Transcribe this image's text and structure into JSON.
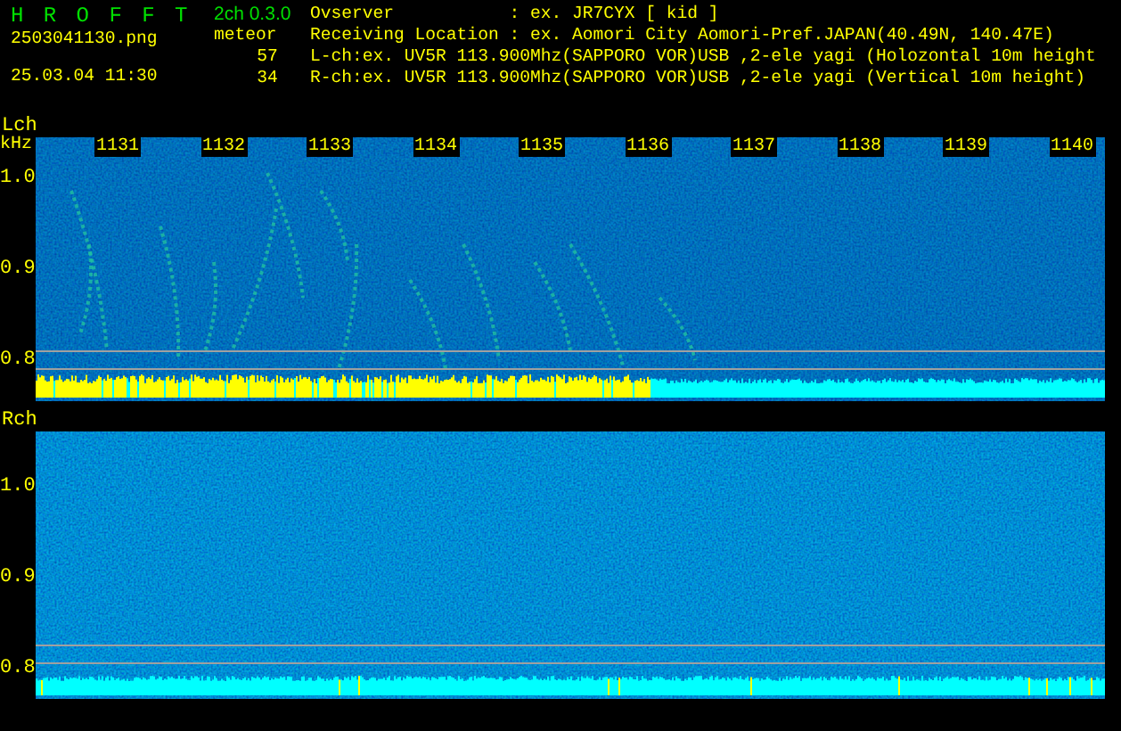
{
  "app": {
    "title": "H R O F F T",
    "version": "2ch 0.3.0",
    "filename": "2503041130.png",
    "datetime": "25.03.04 11:30"
  },
  "meteor": {
    "label": "meteor",
    "counts": [
      "57",
      "34"
    ]
  },
  "info_lines": [
    "Ovserver           : ex. JR7CYX [ kid ]",
    "Receiving Location : ex. Aomori City Aomori-Pref.JAPAN(40.49N, 140.47E)",
    "L-ch:ex. UV5R 113.900Mhz(SAPPORO VOR)USB ,2-ele yagi (Holozontal 10m height",
    "R-ch:ex. UV5R 113.900Mhz(SAPPORO VOR)USB ,2-ele yagi (Vertical 10m height)"
  ],
  "channels": [
    {
      "kind": "lch",
      "label": "Lch",
      "unit": "kHz",
      "y_labels": [
        "1.0",
        "0.9",
        "0.8"
      ],
      "time_labels": [
        "1131",
        "1132",
        "1133",
        "1134",
        "1135",
        "1136",
        "1137",
        "1138",
        "1139",
        "1140"
      ]
    },
    {
      "kind": "rch",
      "label": "Rch",
      "y_labels": [
        "1.0",
        "0.9",
        "0.8"
      ]
    }
  ]
}
